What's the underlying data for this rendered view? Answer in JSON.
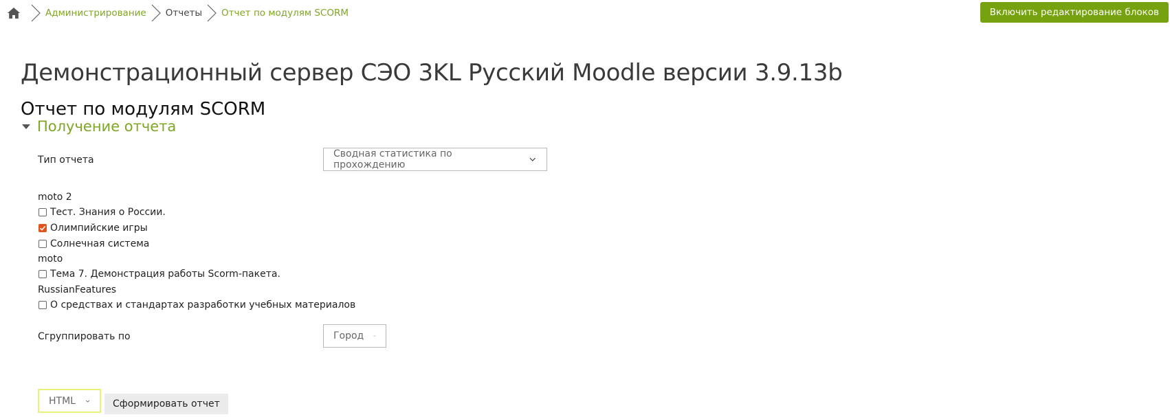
{
  "breadcrumb": {
    "home_icon": "home-icon",
    "items": [
      "Администрирование",
      "Отчеты",
      "Отчет по модулям SCORM"
    ]
  },
  "header": {
    "edit_blocks_button": "Включить редактирование блоков",
    "site_title": "Демонстрационный сервер СЭО 3KL Русский Moodle версии 3.9.13b",
    "page_title": "Отчет по модулям SCORM"
  },
  "form": {
    "section_title": "Получение отчета",
    "report_type": {
      "label": "Тип отчета",
      "value": "Сводная статистика по прохождению"
    },
    "courses": [
      {
        "heading": "moto 2",
        "modules": [
          {
            "label": "Тест. Знания о России.",
            "checked": false
          },
          {
            "label": "Олимпийские игры",
            "checked": true
          },
          {
            "label": "Солнечная система",
            "checked": false
          }
        ]
      },
      {
        "heading": "moto",
        "modules": [
          {
            "label": "Тема 7. Демонстрация работы Scorm-пакета.",
            "checked": false
          }
        ]
      },
      {
        "heading": "RussianFeatures",
        "modules": [
          {
            "label": "О средствах и стандартах разработки учебных материалов",
            "checked": false
          }
        ]
      }
    ],
    "group_by": {
      "label": "Сгруппировать по",
      "value": "Город"
    },
    "format": {
      "value": "HTML"
    },
    "generate_button": "Сформировать отчет"
  },
  "colors": {
    "accent": "#7fa625",
    "button": "#76a20f",
    "checkbox_checked": "#e0531f",
    "format_border": "#e8f27a"
  }
}
